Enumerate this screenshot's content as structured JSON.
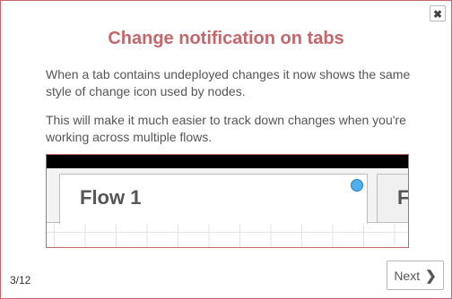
{
  "dialog": {
    "close_icon": "close-icon",
    "close_glyph": "✖",
    "title": "Change notification on tabs",
    "paragraph1": "When a tab contains undeployed changes it now shows the same style of change icon used by nodes.",
    "paragraph2": "This will make it much easier to track down changes when you're working across multiple flows.",
    "accent_color": "#c4676b"
  },
  "preview": {
    "active_tab_label": "Flow 1",
    "next_tab_label": "F",
    "change_indicator_icon": "blue-dot-icon",
    "change_indicator_color": "#4db0ec"
  },
  "footer": {
    "page_counter": "3/12",
    "next_label": "Next",
    "next_icon": "chevron-right-icon",
    "next_glyph": "❯"
  }
}
